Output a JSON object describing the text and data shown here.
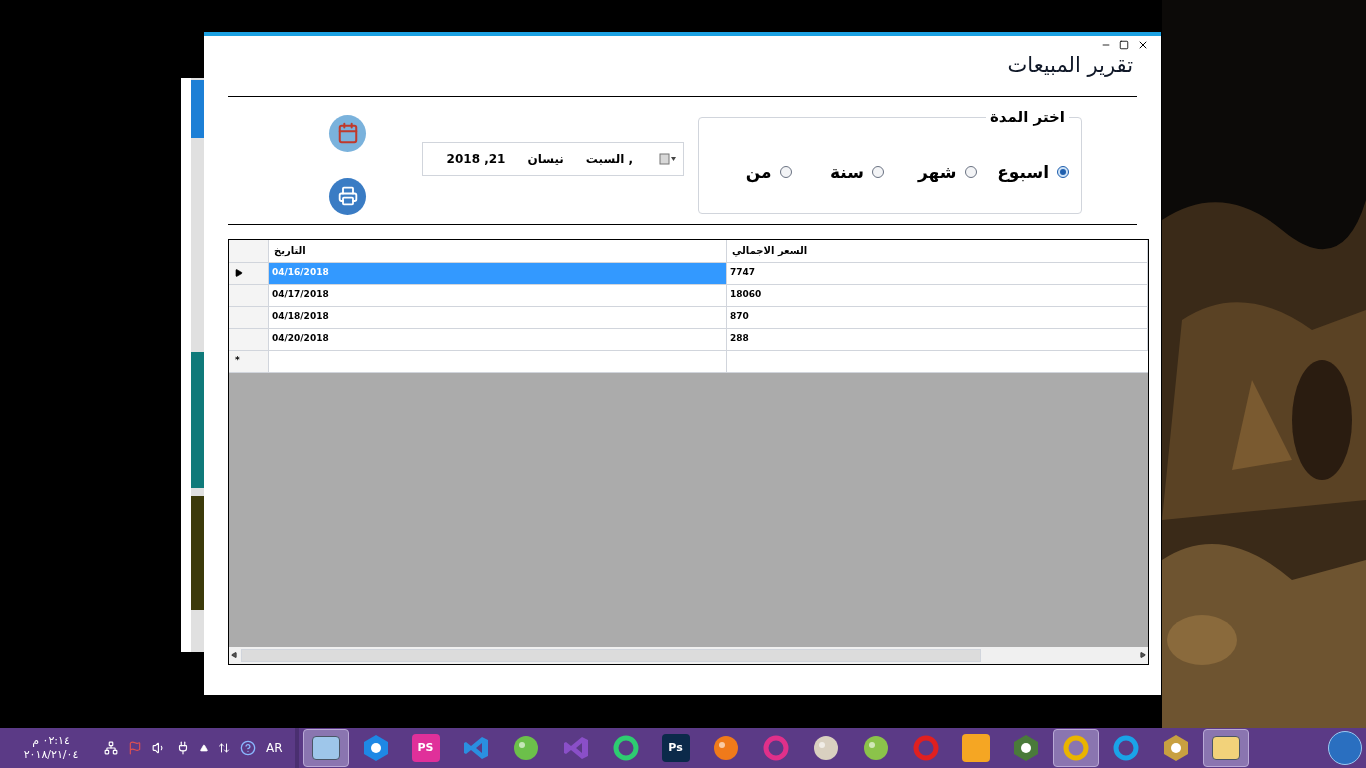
{
  "window": {
    "title": "تقرير المبيعات"
  },
  "period": {
    "legend": "اختر المدة",
    "options": [
      {
        "label": "اسبوع",
        "selected": true
      },
      {
        "label": "شهر",
        "selected": false
      },
      {
        "label": "سنة",
        "selected": false
      },
      {
        "label": "من",
        "selected": false
      }
    ]
  },
  "date_picker": {
    "parts": [
      "السبت ,",
      "نيسان",
      "2018 ,21"
    ]
  },
  "grid": {
    "columns": [
      "السعر الاجمالي",
      "التاريخ"
    ],
    "rows": [
      {
        "cells": [
          "7747",
          "04/16/2018"
        ],
        "selected": true
      },
      {
        "cells": [
          "18060",
          "04/17/2018"
        ],
        "selected": false
      },
      {
        "cells": [
          "870",
          "04/18/2018"
        ],
        "selected": false
      },
      {
        "cells": [
          "288",
          "04/20/2018"
        ],
        "selected": false
      }
    ],
    "new_row_marker": "*"
  },
  "taskbar": {
    "apps": [
      {
        "kind": "window",
        "color": "#f2d27a",
        "selected": true
      },
      {
        "kind": "hexagon",
        "color": "#c8a040",
        "selected": false
      },
      {
        "kind": "ring",
        "color": "#1aa3e8",
        "selected": false
      },
      {
        "kind": "ring",
        "color": "#e9b400",
        "selected": true
      },
      {
        "kind": "hexagon",
        "color": "#4a7a3a",
        "selected": false
      },
      {
        "kind": "tile",
        "color": "#f5a623",
        "selected": false
      },
      {
        "kind": "ring",
        "color": "#e02020",
        "selected": false
      },
      {
        "kind": "blob",
        "color": "#8bc34a",
        "selected": false
      },
      {
        "kind": "blob",
        "color": "#d9d0c0",
        "selected": false
      },
      {
        "kind": "ring",
        "color": "#e0308a",
        "selected": false
      },
      {
        "kind": "blob",
        "color": "#f07a1a",
        "selected": false
      },
      {
        "kind": "tile",
        "color": "#0b2a4a",
        "label": "Ps",
        "selected": false
      },
      {
        "kind": "ring",
        "color": "#2ecc71",
        "selected": false
      },
      {
        "kind": "code",
        "color": "#8a4fc8",
        "selected": false
      },
      {
        "kind": "blob",
        "color": "#6cc04a",
        "selected": false
      },
      {
        "kind": "code",
        "color": "#2a8fe0",
        "selected": false
      },
      {
        "kind": "tile",
        "color": "#e0309a",
        "label": "PS",
        "selected": false
      },
      {
        "kind": "hexagon",
        "color": "#1e88e5",
        "selected": false
      },
      {
        "kind": "window",
        "color": "#9ec6ea",
        "selected": true
      }
    ],
    "language": "AR",
    "clock": {
      "time": "٠٢:١٤ م",
      "date": "٢٠١٨/٢١/٠٤"
    }
  }
}
